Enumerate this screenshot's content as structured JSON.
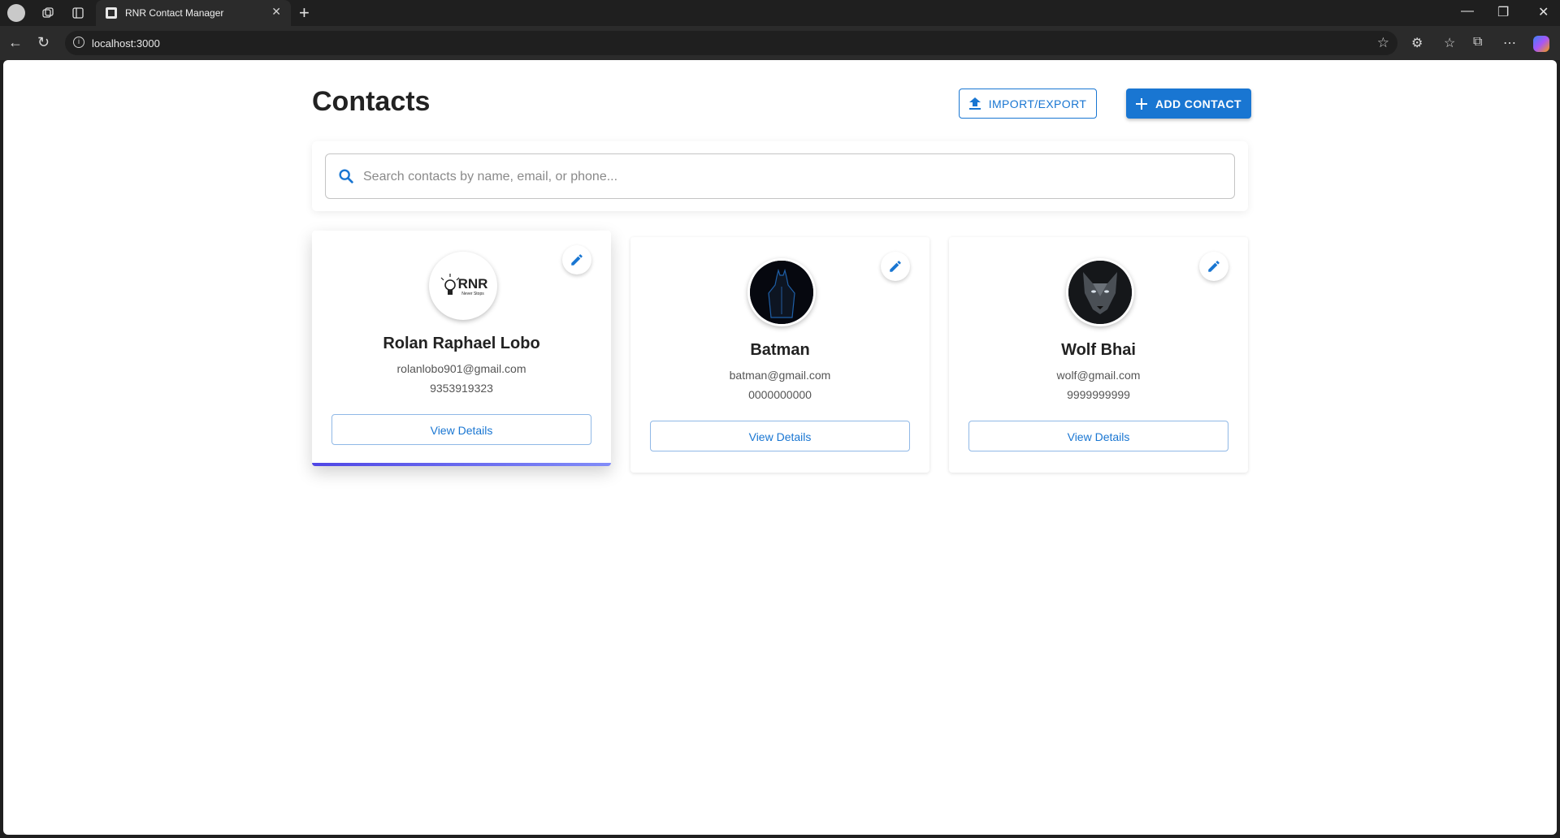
{
  "browser": {
    "tab_title": "RNR Contact Manager",
    "url": "localhost:3000"
  },
  "page": {
    "title": "Contacts",
    "import_export_label": "IMPORT/EXPORT",
    "add_contact_label": "ADD CONTACT",
    "search_placeholder": "Search contacts by name, email, or phone...",
    "view_details_label": "View Details"
  },
  "contacts": [
    {
      "name": "Rolan Raphael Lobo",
      "email": "rolanlobo901@gmail.com",
      "phone": "9353919323",
      "avatar": "rnr-logo-avatar"
    },
    {
      "name": "Batman",
      "email": "batman@gmail.com",
      "phone": "0000000000",
      "avatar": "batman-avatar"
    },
    {
      "name": "Wolf Bhai",
      "email": "wolf@gmail.com",
      "phone": "9999999999",
      "avatar": "wolf-avatar"
    }
  ],
  "logo_text": {
    "main": "RNR",
    "tagline": "Never Stops"
  },
  "colors": {
    "primary": "#1976d2",
    "accent": "#4f46e5"
  }
}
